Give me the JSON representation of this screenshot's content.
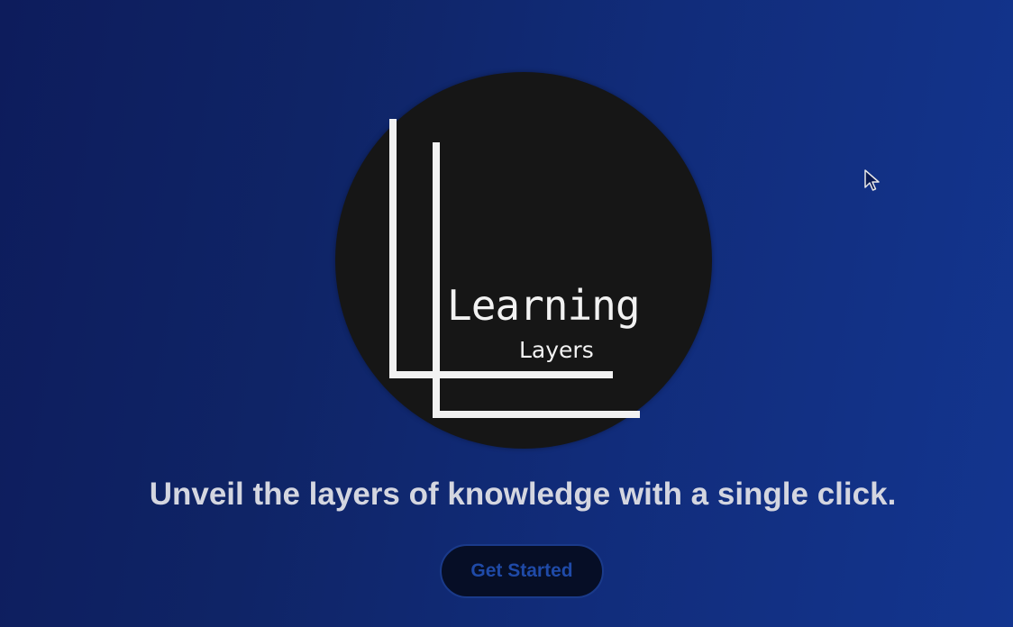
{
  "logo": {
    "title": "Learning",
    "subtitle": "Layers"
  },
  "hero": {
    "tagline": "Unveil the layers of knowledge with a single click."
  },
  "cta": {
    "label": "Get Started"
  },
  "colors": {
    "background_start": "#0d1c5c",
    "background_end": "#13358f",
    "logo_circle": "#161616",
    "logo_lines": "#f2f2f2",
    "tagline_text": "#d4d6e0",
    "button_bg": "#060e26",
    "button_text": "#1f4aa8"
  },
  "icons": {
    "cursor": "mouse-pointer-icon"
  }
}
